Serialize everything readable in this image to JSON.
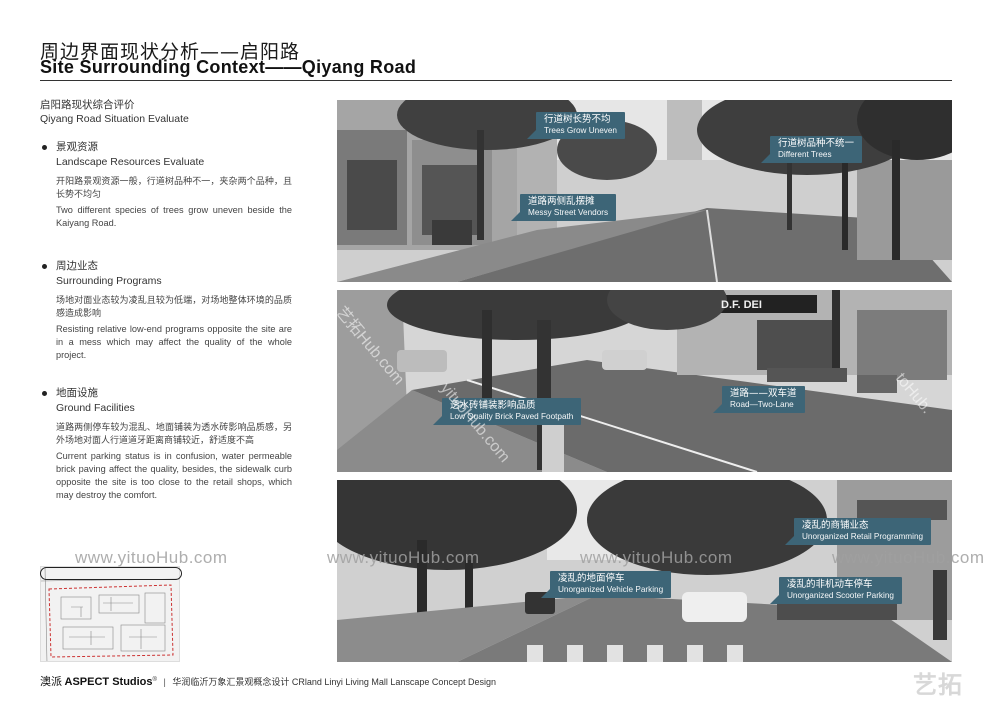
{
  "header": {
    "title_cn": "周边界面现状分析——启阳路",
    "title_en": "Site Surrounding Context——Qiyang Road"
  },
  "evaluation": {
    "heading_cn": "启阳路现状综合评价",
    "heading_en": "Qiyang Road Situation Evaluate",
    "items": [
      {
        "title_cn": "景观资源",
        "title_en": "Landscape Resources Evaluate",
        "body_cn": "开阳路景观资源一般，行道树品种不一，夹杂两个品种，且长势不均匀",
        "body_en": "Two different species of trees grow uneven beside the Kaiyang Road."
      },
      {
        "title_cn": "周边业态",
        "title_en": "Surrounding Programs",
        "body_cn": "场地对面业态较为凌乱且较为低端，对场地整体环境的品质感造成影响",
        "body_en": "Resisting relative low-end programs opposite the site are in a mess which may affect the quality of the whole project."
      },
      {
        "title_cn": "地面设施",
        "title_en": "Ground Facilities",
        "body_cn": "道路两侧停车较为混乱、地面铺装为透水砖影响品质感，另外场地对面人行道道牙距离商铺较近，舒适度不高",
        "body_en": "Current parking status is in confusion, water permeable brick paving affect the quality, besides, the sidewalk curb opposite the site is too close to the retail shops, which may destroy the comfort."
      }
    ]
  },
  "photos": [
    {
      "callouts": [
        {
          "cn": "行道树长势不均",
          "en": "Trees Grow Uneven"
        },
        {
          "cn": "行道树品种不统一",
          "en": "Different Trees"
        },
        {
          "cn": "道路两侧乱摆摊",
          "en": "Messy Street Vendors"
        }
      ]
    },
    {
      "shop_sign": "D.F. DEI",
      "callouts": [
        {
          "cn": "透水砖铺装影响品质",
          "en": "Low Quality Brick Paved Footpath"
        },
        {
          "cn": "道路——双车道",
          "en": "Road—Two-Lane"
        }
      ]
    },
    {
      "callouts": [
        {
          "cn": "凌乱的商铺业态",
          "en": "Unorganized Retail Programming"
        },
        {
          "cn": "凌乱的地面停车",
          "en": "Unorganized Vehicle Parking"
        },
        {
          "cn": "凌乱的非机动车停车",
          "en": "Unorganized Scooter Parking"
        }
      ]
    }
  ],
  "watermarks": {
    "text": "www.yituoHub.com",
    "diagonal_1": "艺拓Hub.com",
    "diagonal_2": "yituoHub.com",
    "diagonal_3": "toHub."
  },
  "footer": {
    "brand_cn": "澳派",
    "brand_en": "ASPECT Studios",
    "registered": "®",
    "separator": "|",
    "project_cn": "华润临沂万象汇景观概念设计",
    "project_en": "CRland Linyi Living Mall Lanscape Concept Design",
    "logo_mark": "艺拓"
  },
  "colors": {
    "callout_bg": "#3d6577",
    "rule": "#333333"
  }
}
